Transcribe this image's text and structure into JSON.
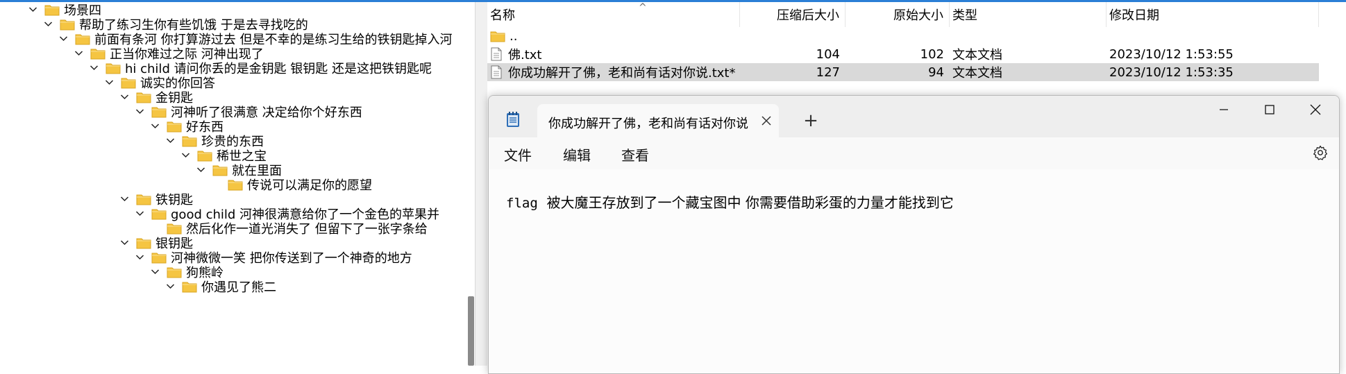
{
  "tree": {
    "nodes": [
      {
        "label": "场景四",
        "expanded": true
      },
      {
        "label": "帮助了练习生你有些饥饿 于是去寻找吃的",
        "expanded": true
      },
      {
        "label": "前面有条河 你打算游过去 但是不幸的是练习生给的铁钥匙掉入河",
        "expanded": true
      },
      {
        "label": "正当你难过之际 河神出现了",
        "expanded": true
      },
      {
        "label": "hi child  请问你丢的是金钥匙 银钥匙 还是这把铁钥匙呢",
        "expanded": true
      },
      {
        "label": "诚实的你回答",
        "expanded": true
      },
      {
        "label": "金钥匙",
        "expanded": true
      },
      {
        "label": "河神听了很满意 决定给你个好东西",
        "expanded": true
      },
      {
        "label": "好东西",
        "expanded": true
      },
      {
        "label": "珍贵的东西",
        "expanded": true
      },
      {
        "label": "稀世之宝",
        "expanded": true
      },
      {
        "label": "就在里面",
        "expanded": true
      },
      {
        "label": "传说可以满足你的愿望",
        "expanded": false
      },
      {
        "label": "铁钥匙",
        "expanded": true
      },
      {
        "label": "good child 河神很满意给你了一个金色的苹果并",
        "expanded": true
      },
      {
        "label": "然后化作一道光消失了 但留下了一张字条给",
        "expanded": false
      },
      {
        "label": "银钥匙",
        "expanded": true
      },
      {
        "label": "河神微微一笑 把你传送到了一个神奇的地方",
        "expanded": true
      },
      {
        "label": "狗熊岭",
        "expanded": true
      },
      {
        "label": "你遇见了熊二",
        "expanded": true
      }
    ]
  },
  "filelist": {
    "columns": [
      "名称",
      "压缩后大小",
      "原始大小",
      "类型",
      "修改日期"
    ],
    "parent": "..",
    "rows": [
      {
        "name": "佛.txt",
        "packed": "104",
        "size": "102",
        "type": "文本文档",
        "modified": "2023/10/12 1:53:55",
        "selected": false
      },
      {
        "name": "你成功解开了佛，老和尚有话对你说.txt*",
        "packed": "127",
        "size": "94",
        "type": "文本文档",
        "modified": "2023/10/12 1:53:35",
        "selected": true
      }
    ]
  },
  "notepad": {
    "tab_title": "你成功解开了佛，老和尚有话对你说",
    "new_tab": "+",
    "menu": [
      "文件",
      "编辑",
      "查看"
    ],
    "content_prefix": "flag",
    "content_body": "  被大魔王存放到了一个藏宝图中 你需要借助彩蛋的力量才能找到它"
  },
  "colors": {
    "accent": "#2b7fd6",
    "folder": "#f5c542",
    "selection": "#d9d9d9"
  }
}
